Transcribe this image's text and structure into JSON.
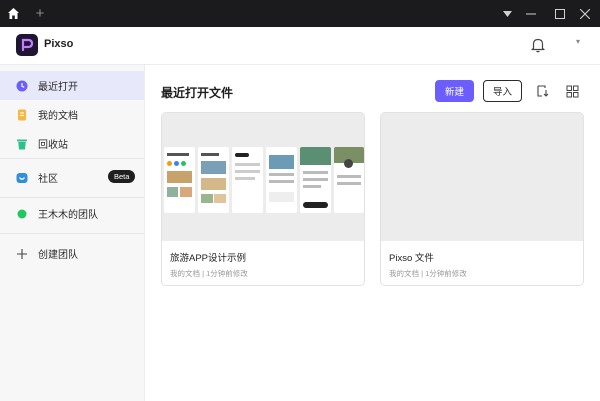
{
  "app": {
    "brand": "Pixso"
  },
  "sidebar": {
    "items": [
      {
        "label": "最近打开",
        "icon": "clock-icon"
      },
      {
        "label": "我的文档",
        "icon": "document-icon"
      },
      {
        "label": "回收站",
        "icon": "trash-icon"
      },
      {
        "label": "社区",
        "icon": "community-icon",
        "badge": "Beta"
      },
      {
        "label": "王木木的团队",
        "icon": "team-dot-icon"
      },
      {
        "label": "创建团队",
        "icon": "plus-icon"
      }
    ]
  },
  "main": {
    "title": "最近打开文件",
    "new_label": "新建",
    "import_label": "导入"
  },
  "files": [
    {
      "name": "旅游APP设计示例",
      "meta": "我的文档 | 1分钟前修改"
    },
    {
      "name": "Pixso 文件",
      "meta": "我的文档 | 1分钟前修改"
    }
  ],
  "colors": {
    "accent": "#6c5dff",
    "titlebar": "#1b1b1d"
  }
}
